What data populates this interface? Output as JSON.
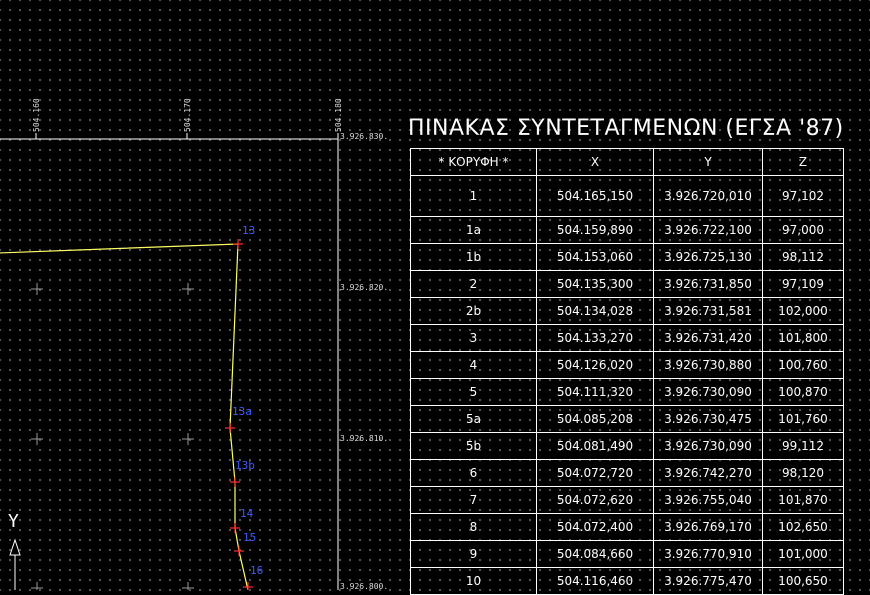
{
  "grid_labels": {
    "x": [
      "504.160",
      "504.170",
      "504.180"
    ],
    "y": [
      "3.926.830.",
      "3.926.820.",
      "3.926.810.",
      "3.926.800."
    ]
  },
  "points": [
    "13",
    "13a",
    "13b",
    "14",
    "15",
    "16"
  ],
  "ucs_axis_label": "Y",
  "table": {
    "title": "ΠΙΝΑΚΑΣ ΣΥΝΤΕΤΑΓΜΕΝΩΝ (ΕΓΣΑ '87)",
    "headers": [
      "* ΚΟΡΥΦΗ *",
      "X",
      "Y",
      "Z"
    ],
    "rows": [
      [
        "1",
        "504.165,150",
        "3.926.720,010",
        "97,102"
      ],
      [
        "1a",
        "504.159,890",
        "3.926.722,100",
        "97,000"
      ],
      [
        "1b",
        "504.153,060",
        "3.926.725,130",
        "98,112"
      ],
      [
        "2",
        "504.135,300",
        "3.926.731,850",
        "97,109"
      ],
      [
        "2b",
        "504.134,028",
        "3.926.731,581",
        "102,000"
      ],
      [
        "3",
        "504.133,270",
        "3.926.731,420",
        "101,800"
      ],
      [
        "4",
        "504.126,020",
        "3.926.730,880",
        "100,760"
      ],
      [
        "5",
        "504.111,320",
        "3.926.730,090",
        "100,870"
      ],
      [
        "5a",
        "504.085,208",
        "3.926.730,475",
        "101,760"
      ],
      [
        "5b",
        "504.081,490",
        "3.926.730,090",
        "99,112"
      ],
      [
        "6",
        "504.072,720",
        "3.926.742,270",
        "98,120"
      ],
      [
        "7",
        "504.072,620",
        "3.926.755,040",
        "101,870"
      ],
      [
        "8",
        "504.072,400",
        "3.926.769,170",
        "102,650"
      ],
      [
        "9",
        "504.084,660",
        "3.926.770,910",
        "101,000"
      ],
      [
        "10",
        "504.116,460",
        "3.926.775,470",
        "100,650"
      ]
    ]
  },
  "colors": {
    "background": "#000000",
    "boundary_line": "#ffff66",
    "point_marker": "#ff3030",
    "point_label": "#3a5cff",
    "frame": "#ffffff"
  }
}
